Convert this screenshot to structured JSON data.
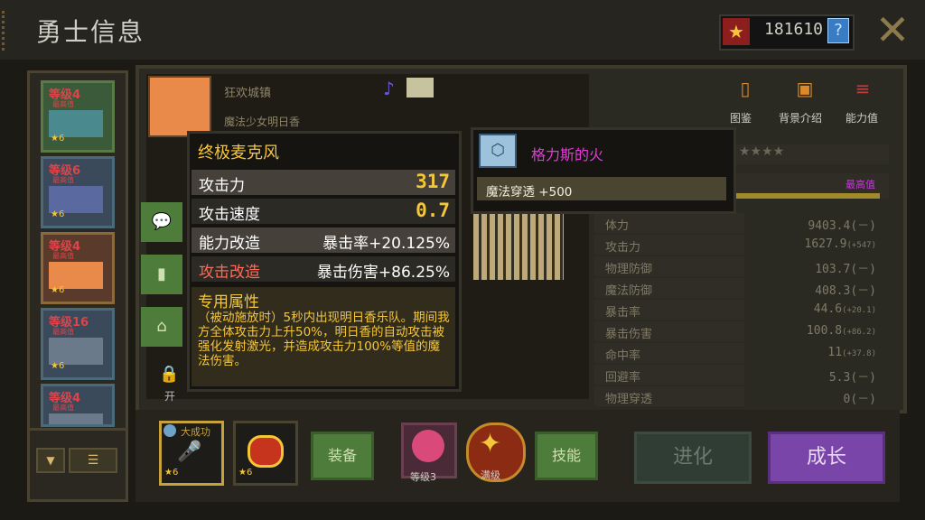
{
  "header": {
    "title": "勇士信息",
    "gold": "181610",
    "help_symbol": "?",
    "close_symbol": "✕"
  },
  "hero_list": [
    {
      "level": "等级4",
      "sub": "最高值",
      "stars": "★6"
    },
    {
      "level": "等级6",
      "sub": "最高值",
      "stars": "★6"
    },
    {
      "level": "等级4",
      "sub": "最高值",
      "stars": "★6"
    },
    {
      "level": "等级16",
      "sub": "最高值",
      "stars": "★6"
    },
    {
      "level": "等级4",
      "sub": "最高值",
      "stars": "★6"
    }
  ],
  "hero": {
    "location": "狂欢城镇",
    "name": "魔法少女明日香",
    "lock_label": "开"
  },
  "top_buttons": {
    "codex": "图鉴",
    "background": "背景介绍",
    "ability": "能力值"
  },
  "level_max": "最高值",
  "rank_stars": "★★★★",
  "stats": [
    {
      "name": "体力",
      "value": "9403.4(－)",
      "bonus": ""
    },
    {
      "name": "攻击力",
      "value": "1627.9",
      "bonus": "(+547)"
    },
    {
      "name": "物理防御",
      "value": "103.7(－)",
      "bonus": ""
    },
    {
      "name": "魔法防御",
      "value": "408.3(－)",
      "bonus": ""
    },
    {
      "name": "暴击率",
      "value": "44.6",
      "bonus": "(+20.1)"
    },
    {
      "name": "暴击伤害",
      "value": "100.8",
      "bonus": "(+86.2)"
    },
    {
      "name": "命中率",
      "value": "11",
      "bonus": "(+37.8)"
    },
    {
      "name": "回避率",
      "value": "5.3(－)",
      "bonus": ""
    },
    {
      "name": "物理穿透",
      "value": "0(－)",
      "bonus": ""
    }
  ],
  "weapon": {
    "name": "终极麦克风",
    "attack_label": "攻击力",
    "attack_value": "317",
    "speed_label": "攻击速度",
    "speed_value": "0.7",
    "ability_mod_label": "能力改造",
    "ability_mod_value": "暴击率+20.125%",
    "attack_mod_label": "攻击改造",
    "attack_mod_value": "暴击伤害+86.25%",
    "special_title": "专用属性",
    "special_text": "（被动施放时）5秒内出现明日香乐队。期间我方全体攻击力上升50%，明日香的自动攻击被强化发射激光，并造成攻击力100%等值的魔法伤害。"
  },
  "artifact": {
    "name": "格力斯的火",
    "effect": "魔法穿透 +500"
  },
  "bottom": {
    "eq1_label": "大成功",
    "eq1_stars": "★6",
    "eq2_stars": "★6",
    "equip_btn": "装备",
    "skill1_label": "等级3",
    "skill2_label": "满级",
    "skill_btn": "技能",
    "evolve_btn": "进化",
    "grow_btn": "成长"
  },
  "colors": {
    "gold": "#f5c63a",
    "magenta": "#e43ad8",
    "green_button": "#4e7c3a",
    "purple_button": "#7a45a8"
  }
}
